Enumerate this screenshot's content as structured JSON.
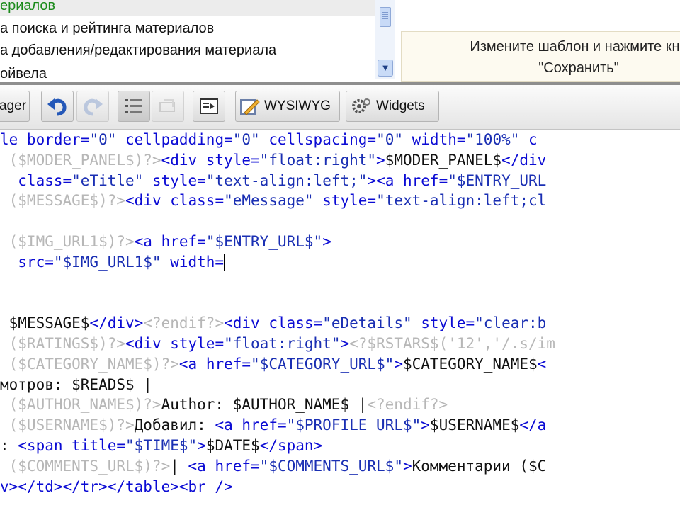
{
  "templates_list": {
    "items": [
      {
        "label": "ериалов",
        "selected": true
      },
      {
        "label": "а поиска и рейтинга материалов",
        "selected": false
      },
      {
        "label": "а добавления/редактирования материала",
        "selected": false
      },
      {
        "label": "ойвела",
        "selected": false
      }
    ]
  },
  "hint": {
    "line1": "Измените шаблон и нажмите кно",
    "line2": "\"Сохранить\""
  },
  "toolbar": {
    "manager_label": "ager",
    "wysiwyg_label": "WYSIWYG",
    "widgets_label": "Widgets"
  },
  "colors": {
    "tag": "#0b0bd4",
    "string": "#1a2fb3",
    "directive": "#b7b7b7",
    "text": "#111111",
    "selected_item": "#1a8a1a"
  },
  "code": {
    "lines": [
      [
        [
          "t-attr",
          "le border="
        ],
        [
          "t-str",
          "\"0\""
        ],
        [
          "t-attr",
          " cellpadding="
        ],
        [
          "t-str",
          "\"0\""
        ],
        [
          "t-attr",
          " cellspacing="
        ],
        [
          "t-str",
          "\"0\""
        ],
        [
          "t-attr",
          " width="
        ],
        [
          "t-str",
          "\"100%\""
        ],
        [
          "t-attr",
          " c"
        ]
      ],
      [
        [
          "t-dir",
          " ($MODER_PANEL$)?>"
        ],
        [
          "t-tag",
          "<div"
        ],
        [
          "t-attr",
          " style="
        ],
        [
          "t-str",
          "\"float:right\""
        ],
        [
          "t-tag",
          ">"
        ],
        [
          "t-var",
          "$MODER_PANEL$"
        ],
        [
          "t-tag",
          "</div"
        ]
      ],
      [
        [
          "t-attr",
          "  class="
        ],
        [
          "t-str",
          "\"eTitle\""
        ],
        [
          "t-attr",
          " style="
        ],
        [
          "t-str",
          "\"text-align:left;\""
        ],
        [
          "t-tag",
          ">"
        ],
        [
          "t-tag",
          "<a"
        ],
        [
          "t-attr",
          " href="
        ],
        [
          "t-str",
          "\"$ENTRY_URL"
        ]
      ],
      [
        [
          "t-dir",
          " ($MESSAGE$)?>"
        ],
        [
          "t-tag",
          "<div"
        ],
        [
          "t-attr",
          " class="
        ],
        [
          "t-str",
          "\"eMessage\""
        ],
        [
          "t-attr",
          " style="
        ],
        [
          "t-str",
          "\"text-align:left;cl"
        ]
      ],
      [],
      [
        [
          "t-dir",
          " ($IMG_URL1$)?>"
        ],
        [
          "t-tag",
          "<a"
        ],
        [
          "t-attr",
          " href="
        ],
        [
          "t-str",
          "\"$ENTRY_URL$\""
        ],
        [
          "t-tag",
          ">"
        ]
      ],
      [
        [
          "t-attr",
          "  src="
        ],
        [
          "t-str",
          "\"$IMG_URL1$\""
        ],
        [
          "t-attr",
          " width="
        ]
      ],
      [],
      [],
      [
        [
          "t-var",
          " $MESSAGE$"
        ],
        [
          "t-tag",
          "</div>"
        ],
        [
          "t-dir",
          "<?endif?>"
        ],
        [
          "t-tag",
          "<div"
        ],
        [
          "t-attr",
          " class="
        ],
        [
          "t-str",
          "\"eDetails\""
        ],
        [
          "t-attr",
          " style="
        ],
        [
          "t-str",
          "\"clear:b"
        ]
      ],
      [
        [
          "t-dir",
          " ($RATINGS$)?>"
        ],
        [
          "t-tag",
          "<div"
        ],
        [
          "t-attr",
          " style="
        ],
        [
          "t-str",
          "\"float:right\""
        ],
        [
          "t-tag",
          ">"
        ],
        [
          "t-dir",
          "<?$RSTARS$('12','/.s/im"
        ]
      ],
      [
        [
          "t-dir",
          " ($CATEGORY_NAME$)?>"
        ],
        [
          "t-tag",
          "<a"
        ],
        [
          "t-attr",
          " href="
        ],
        [
          "t-str",
          "\"$CATEGORY_URL$\""
        ],
        [
          "t-tag",
          ">"
        ],
        [
          "t-var",
          "$CATEGORY_NAME$"
        ],
        [
          "t-tag",
          "<"
        ]
      ],
      [
        [
          "t-txt",
          "мотров: $READS$ |"
        ]
      ],
      [
        [
          "t-dir",
          " ($AUTHOR_NAME$)?>"
        ],
        [
          "t-txt",
          "Author: $AUTHOR_NAME$ |"
        ],
        [
          "t-dir",
          "<?endif?>"
        ]
      ],
      [
        [
          "t-dir",
          " ($USERNAME$)?>"
        ],
        [
          "t-txt",
          "Добавил: "
        ],
        [
          "t-tag",
          "<a"
        ],
        [
          "t-attr",
          " href="
        ],
        [
          "t-str",
          "\"$PROFILE_URL$\""
        ],
        [
          "t-tag",
          ">"
        ],
        [
          "t-var",
          "$USERNAME$"
        ],
        [
          "t-tag",
          "</a"
        ]
      ],
      [
        [
          "t-txt",
          ": "
        ],
        [
          "t-tag",
          "<span"
        ],
        [
          "t-attr",
          " title="
        ],
        [
          "t-str",
          "\"$TIME$\""
        ],
        [
          "t-tag",
          ">"
        ],
        [
          "t-var",
          "$DATE$"
        ],
        [
          "t-tag",
          "</span>"
        ]
      ],
      [
        [
          "t-dir",
          " ($COMMENTS_URL$)?>"
        ],
        [
          "t-txt",
          "| "
        ],
        [
          "t-tag",
          "<a"
        ],
        [
          "t-attr",
          " href="
        ],
        [
          "t-str",
          "\"$COMMENTS_URL$\""
        ],
        [
          "t-tag",
          ">"
        ],
        [
          "t-txt",
          "Комментарии ($C"
        ]
      ],
      [
        [
          "t-tag",
          "v></td></tr></table><br />"
        ]
      ]
    ]
  }
}
